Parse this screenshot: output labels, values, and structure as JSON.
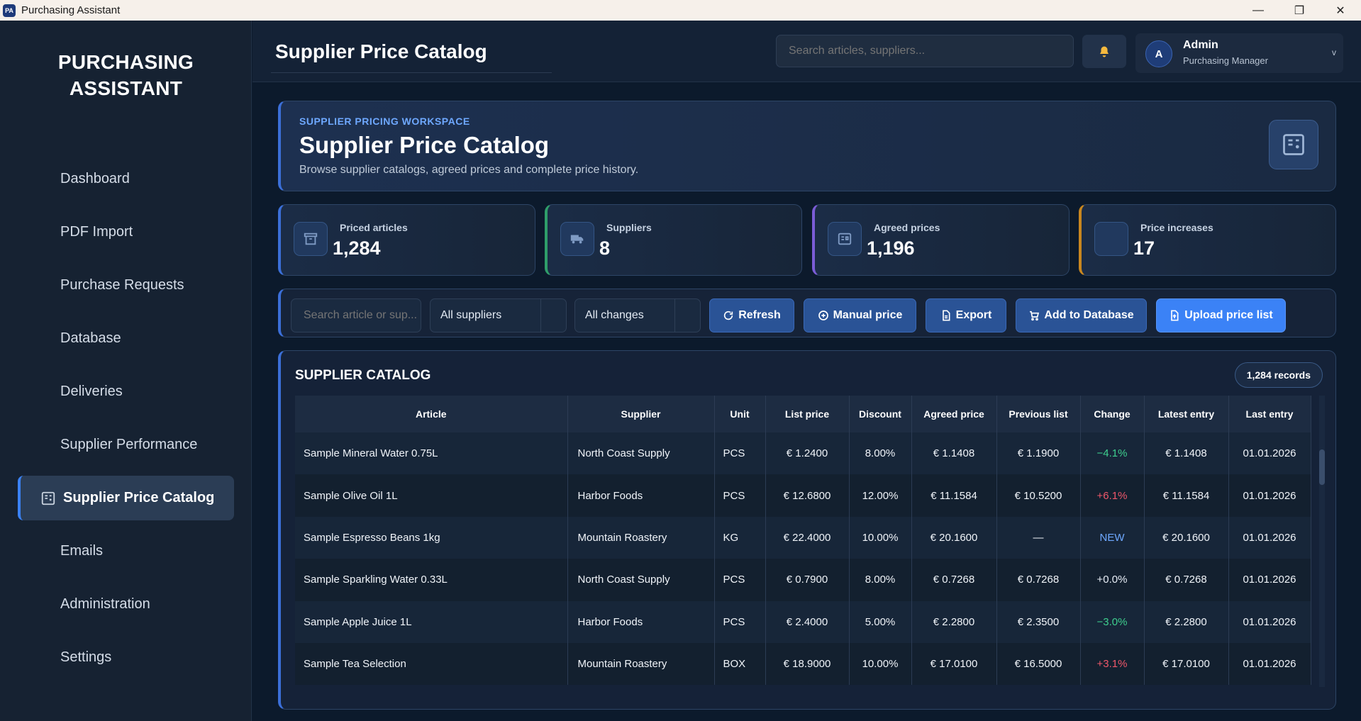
{
  "window": {
    "title": "Purchasing Assistant",
    "app_icon_text": "PA"
  },
  "sidebar": {
    "brand_line1": "PURCHASING",
    "brand_line2": "ASSISTANT",
    "items": [
      {
        "label": "Dashboard"
      },
      {
        "label": "PDF Import"
      },
      {
        "label": "Purchase Requests"
      },
      {
        "label": "Database"
      },
      {
        "label": "Deliveries"
      },
      {
        "label": "Supplier Performance"
      },
      {
        "label": "Supplier Price Catalog",
        "active": true
      },
      {
        "label": "Emails"
      },
      {
        "label": "Administration"
      },
      {
        "label": "Settings"
      }
    ]
  },
  "topbar": {
    "title": "Supplier Price Catalog",
    "search_placeholder": "Search articles, suppliers...",
    "user": {
      "initial": "A",
      "name": "Admin",
      "role": "Purchasing Manager",
      "caret": "v"
    }
  },
  "hero": {
    "eyebrow": "SUPPLIER PRICING WORKSPACE",
    "title": "Supplier Price Catalog",
    "subtitle": "Browse supplier catalogs, agreed prices and complete price history."
  },
  "kpis": [
    {
      "label": "Priced articles",
      "value": "1,284",
      "accent": "#3b6fd8"
    },
    {
      "label": "Suppliers",
      "value": "8",
      "accent": "#2f9e6a"
    },
    {
      "label": "Agreed prices",
      "value": "1,196",
      "accent": "#7b5cd6"
    },
    {
      "label": "Price increases",
      "value": "17",
      "accent": "#c9871f"
    }
  ],
  "toolbar": {
    "search_placeholder": "Search article or sup...",
    "supplier_filter": "All suppliers",
    "change_filter": "All changes",
    "refresh": "Refresh",
    "manual_price": "Manual price",
    "export": "Export",
    "add_to_db": "Add to Database",
    "upload": "Upload price list"
  },
  "catalog": {
    "title": "SUPPLIER CATALOG",
    "records": "1,284 records",
    "columns": [
      "Article",
      "Supplier",
      "Unit",
      "List price",
      "Discount",
      "Agreed price",
      "Previous list",
      "Change",
      "Latest entry",
      "Last entry"
    ],
    "rows": [
      {
        "article": "Sample Mineral Water 0.75L",
        "supplier": "North Coast Supply",
        "unit": "PCS",
        "list": "€ 1.2400",
        "discount": "8.00%",
        "agreed": "€ 1.1408",
        "prev": "€ 1.1900",
        "change": "−4.1%",
        "change_type": "neg",
        "latest": "€ 1.1408",
        "last": "01.01.2026"
      },
      {
        "article": "Sample Olive Oil 1L",
        "supplier": "Harbor Foods",
        "unit": "PCS",
        "list": "€ 12.6800",
        "discount": "12.00%",
        "agreed": "€ 11.1584",
        "prev": "€ 10.5200",
        "change": "+6.1%",
        "change_type": "pos",
        "latest": "€ 11.1584",
        "last": "01.01.2026"
      },
      {
        "article": "Sample Espresso Beans 1kg",
        "supplier": "Mountain Roastery",
        "unit": "KG",
        "list": "€ 22.4000",
        "discount": "10.00%",
        "agreed": "€ 20.1600",
        "prev": "—",
        "change": "NEW",
        "change_type": "nw",
        "latest": "€ 20.1600",
        "last": "01.01.2026"
      },
      {
        "article": "Sample Sparkling Water 0.33L",
        "supplier": "North Coast Supply",
        "unit": "PCS",
        "list": "€ 0.7900",
        "discount": "8.00%",
        "agreed": "€ 0.7268",
        "prev": "€ 0.7268",
        "change": "+0.0%",
        "change_type": "neu",
        "latest": "€ 0.7268",
        "last": "01.01.2026"
      },
      {
        "article": "Sample Apple Juice 1L",
        "supplier": "Harbor Foods",
        "unit": "PCS",
        "list": "€ 2.4000",
        "discount": "5.00%",
        "agreed": "€ 2.2800",
        "prev": "€ 2.3500",
        "change": "−3.0%",
        "change_type": "neg",
        "latest": "€ 2.2800",
        "last": "01.01.2026"
      },
      {
        "article": "Sample Tea Selection",
        "supplier": "Mountain Roastery",
        "unit": "BOX",
        "list": "€ 18.9000",
        "discount": "10.00%",
        "agreed": "€ 17.0100",
        "prev": "€ 16.5000",
        "change": "+3.1%",
        "change_type": "pos",
        "latest": "€ 17.0100",
        "last": "01.01.2026"
      }
    ]
  },
  "colors": {
    "accent": "#3b82f6",
    "positive_change": "#f0576a",
    "negative_change": "#3ecf8e",
    "new": "#6ea8ff",
    "bell": "#f5b93e"
  }
}
